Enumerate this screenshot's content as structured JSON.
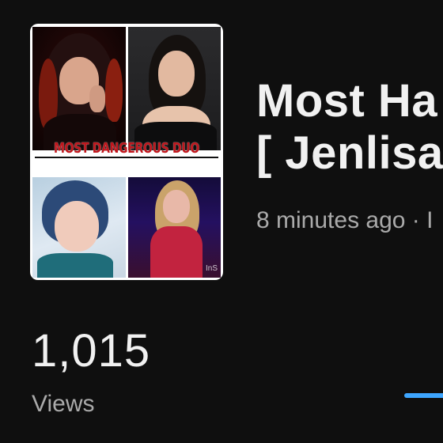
{
  "video": {
    "title_line1": "Most Ha",
    "title_line2": "[ Jenlisa",
    "meta": "8 minutes ago · I"
  },
  "thumbnail": {
    "banner_text": "MOST DANGEROUS DUO",
    "watermark": "InS"
  },
  "stats": {
    "views_value": "1,015",
    "views_label": "Views"
  },
  "colors": {
    "background": "#0f0f0f",
    "primary_text": "#f1f1f1",
    "secondary_text": "#aaaaaa",
    "accent": "#3ea6ff",
    "banner_text": "#c0161c"
  }
}
